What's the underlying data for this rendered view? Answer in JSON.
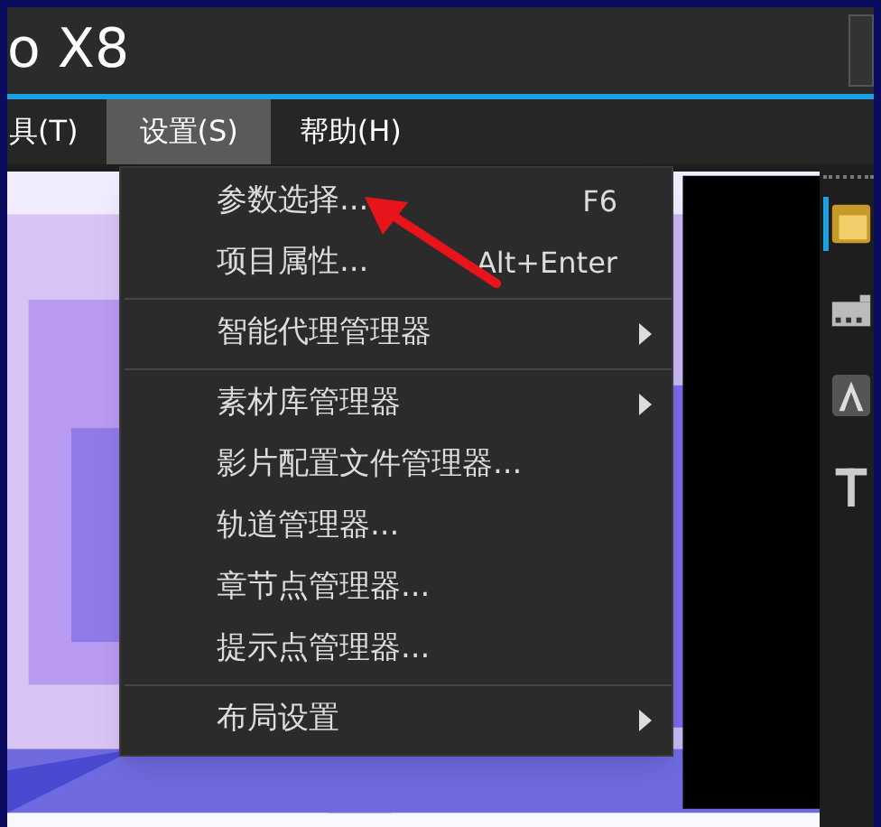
{
  "window": {
    "title": "o X8"
  },
  "menubar": [
    {
      "label": "具(T)",
      "selected": false
    },
    {
      "label": "设置(S)",
      "selected": true
    },
    {
      "label": "帮助(H)",
      "selected": false
    }
  ],
  "menu": [
    {
      "kind": "item",
      "label": "参数选择...",
      "shortcut": "F6",
      "submenu": false
    },
    {
      "kind": "item",
      "label": "项目属性...",
      "shortcut": "Alt+Enter",
      "submenu": false
    },
    {
      "kind": "separator"
    },
    {
      "kind": "item",
      "label": "智能代理管理器",
      "submenu": true
    },
    {
      "kind": "separator"
    },
    {
      "kind": "item",
      "label": "素材库管理器",
      "submenu": true
    },
    {
      "kind": "item",
      "label": "影片配置文件管理器...",
      "submenu": false
    },
    {
      "kind": "item",
      "label": "轨道管理器...",
      "submenu": false
    },
    {
      "kind": "item",
      "label": "章节点管理器...",
      "submenu": false
    },
    {
      "kind": "item",
      "label": "提示点管理器...",
      "submenu": false
    },
    {
      "kind": "separator"
    },
    {
      "kind": "item",
      "label": "布局设置",
      "submenu": true
    }
  ],
  "toolbar": [
    {
      "kind": "media",
      "selected": true
    },
    {
      "kind": "transition",
      "selected": false
    },
    {
      "kind": "title",
      "selected": false
    },
    {
      "kind": "text",
      "selected": false
    }
  ]
}
